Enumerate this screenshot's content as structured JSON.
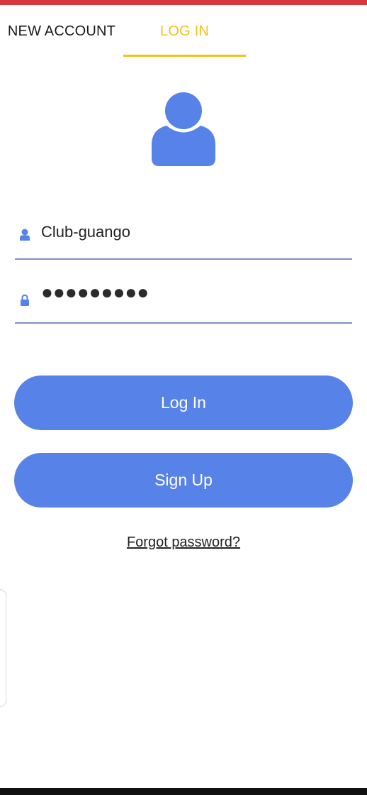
{
  "tabs": [
    {
      "label": "NEW ACCOUNT",
      "active": false
    },
    {
      "label": "LOG IN",
      "active": true
    }
  ],
  "form": {
    "username_value": "Club-guango",
    "password_value": "●●●●●●●●●",
    "username_icon": "user-icon",
    "password_icon": "lock-icon"
  },
  "buttons": {
    "login_label": "Log In",
    "signup_label": "Sign Up"
  },
  "links": {
    "forgot_password": "Forgot password?"
  },
  "colors": {
    "accent_blue": "#5783e8",
    "tab_active": "#f2c21a",
    "top_strip": "#d7363a"
  }
}
